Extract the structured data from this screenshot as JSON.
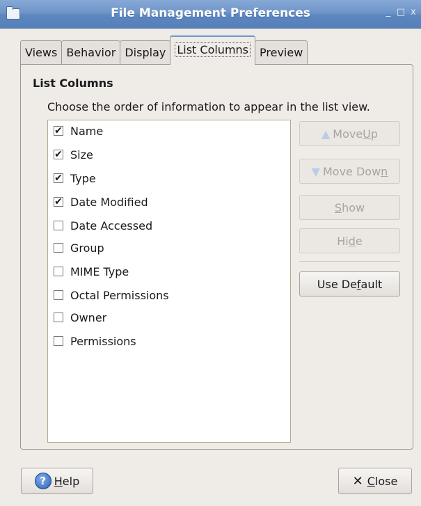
{
  "window": {
    "title": "File Management Preferences",
    "minimize": "_",
    "maximize": "□",
    "close": "x"
  },
  "tabs": [
    {
      "label": "Views"
    },
    {
      "label": "Behavior"
    },
    {
      "label": "Display"
    },
    {
      "label": "List Columns",
      "active": true
    },
    {
      "label": "Preview"
    }
  ],
  "section": {
    "title": "List Columns",
    "description": "Choose the order of information to appear in the list view."
  },
  "columns": [
    {
      "label": "Name",
      "checked": true
    },
    {
      "label": "Size",
      "checked": true
    },
    {
      "label": "Type",
      "checked": true
    },
    {
      "label": "Date Modified",
      "checked": true
    },
    {
      "label": "Date Accessed",
      "checked": false
    },
    {
      "label": "Group",
      "checked": false
    },
    {
      "label": "MIME Type",
      "checked": false
    },
    {
      "label": "Octal Permissions",
      "checked": false
    },
    {
      "label": "Owner",
      "checked": false
    },
    {
      "label": "Permissions",
      "checked": false
    }
  ],
  "buttons": {
    "move_up": {
      "pre": "Move ",
      "mnemonic": "U",
      "post": "p"
    },
    "move_down": {
      "pre": "Move Dow",
      "mnemonic": "n",
      "post": ""
    },
    "show": {
      "pre": "",
      "mnemonic": "S",
      "post": "how"
    },
    "hide": {
      "pre": "Hi",
      "mnemonic": "d",
      "post": "e"
    },
    "use_default": {
      "pre": "Use De",
      "mnemonic": "f",
      "post": "ault"
    },
    "help": {
      "pre": "",
      "mnemonic": "H",
      "post": "elp",
      "icon": "?"
    },
    "close": {
      "pre": "",
      "mnemonic": "C",
      "post": "lose",
      "icon": "✕"
    }
  }
}
